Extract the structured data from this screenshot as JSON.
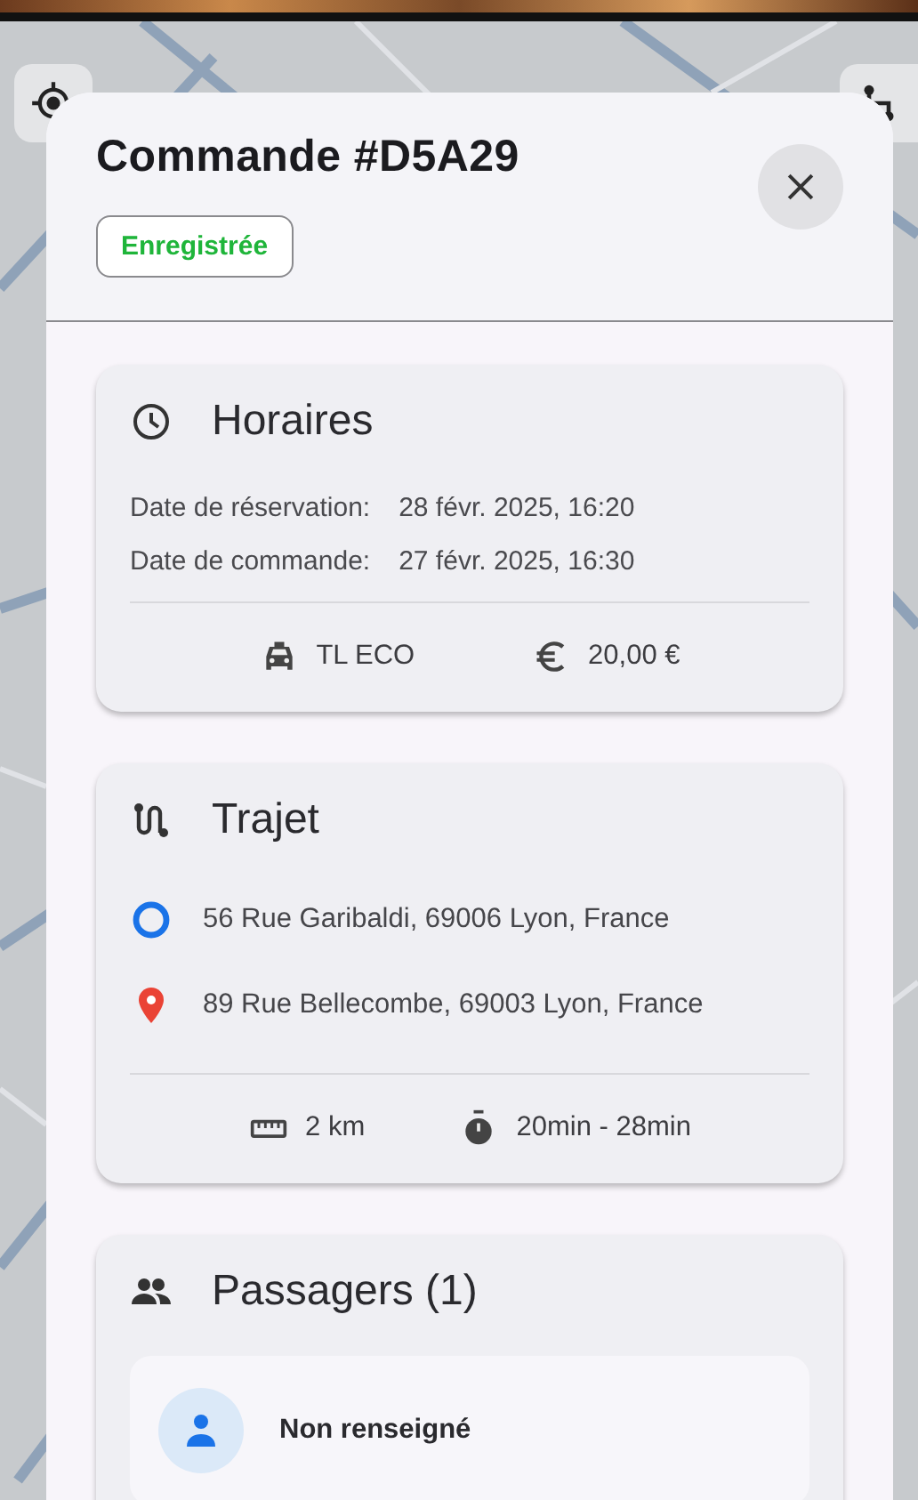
{
  "order": {
    "title": "Commande #D5A29",
    "status": {
      "label": "Enregistrée",
      "color": "#1fb53a"
    }
  },
  "sections": [
    {
      "kind": "schedule",
      "title": "Horaires",
      "rows": [
        {
          "label": "Date de réservation:",
          "value": "28 févr. 2025, 16:20"
        },
        {
          "label": "Date de commande:",
          "value": "27 févr. 2025, 16:30"
        }
      ],
      "footer": [
        {
          "kind": "vehicle",
          "text": "TL ECO"
        },
        {
          "kind": "price",
          "text": "20,00 €"
        }
      ]
    },
    {
      "kind": "route",
      "title": "Trajet",
      "stops": [
        {
          "kind": "origin",
          "address": "56 Rue Garibaldi, 69006 Lyon, France"
        },
        {
          "kind": "destination",
          "address": "89 Rue Bellecombe, 69003 Lyon, France"
        }
      ],
      "footer": [
        {
          "kind": "distance",
          "text": "2 km"
        },
        {
          "kind": "duration",
          "text": "20min - 28min"
        }
      ]
    },
    {
      "kind": "passengers",
      "title": "Passagers (1)",
      "passengers": [
        {
          "name": "Non renseigné"
        }
      ]
    }
  ]
}
